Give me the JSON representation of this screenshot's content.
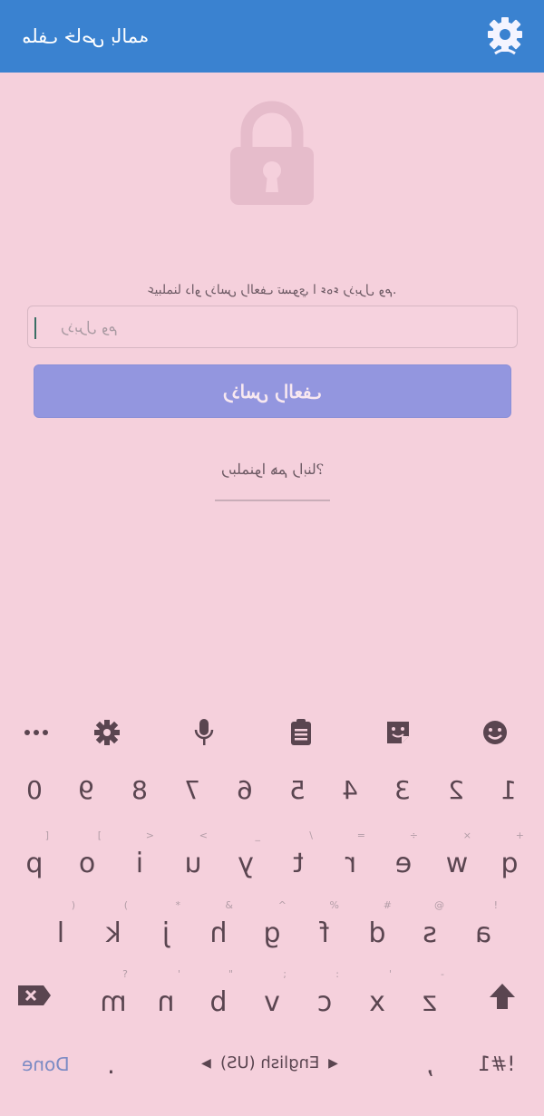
{
  "appbar": {
    "title": "ملف خاص بالمه",
    "accent": "#3a82d0"
  },
  "lock": {
    "icon": "lock-icon"
  },
  "prompt": {
    "text": ".عيبلمنا داو رذلس رالعف تسوي ا ءهء رذبرل وم"
  },
  "password": {
    "placeholder": "رذبرل وم"
  },
  "submit": {
    "label": "رذلس رالعف",
    "color": "#9396df"
  },
  "forgot": {
    "label": "?رىبلمنوا هم رابنا"
  },
  "keyboard": {
    "toolbar": [
      "more-icon",
      "settings-icon",
      "microphone-icon",
      "clipboard-icon",
      "sticker-icon",
      "emoji-icon"
    ],
    "numbers": [
      "0",
      "9",
      "8",
      "7",
      "6",
      "5",
      "4",
      "3",
      "2",
      "1"
    ],
    "row1": [
      {
        "k": "p",
        "h": "]"
      },
      {
        "k": "o",
        "h": "["
      },
      {
        "k": "i",
        "h": ">"
      },
      {
        "k": "u",
        "h": "<"
      },
      {
        "k": "y",
        "h": "_"
      },
      {
        "k": "t",
        "h": "\\"
      },
      {
        "k": "r",
        "h": "="
      },
      {
        "k": "e",
        "h": "÷"
      },
      {
        "k": "w",
        "h": "×"
      },
      {
        "k": "q",
        "h": "+"
      }
    ],
    "row2": [
      {
        "k": "l",
        "h": ")"
      },
      {
        "k": "k",
        "h": "("
      },
      {
        "k": "j",
        "h": "*"
      },
      {
        "k": "h",
        "h": "&"
      },
      {
        "k": "g",
        "h": "^"
      },
      {
        "k": "f",
        "h": "%"
      },
      {
        "k": "d",
        "h": "#"
      },
      {
        "k": "s",
        "h": "@"
      },
      {
        "k": "a",
        "h": "!"
      }
    ],
    "row3": [
      {
        "k": "m",
        "h": "?"
      },
      {
        "k": "n",
        "h": "'"
      },
      {
        "k": "b",
        "h": "\""
      },
      {
        "k": "v",
        "h": ";"
      },
      {
        "k": "c",
        "h": ":"
      },
      {
        "k": "x",
        "h": "'"
      },
      {
        "k": "z",
        "h": "-"
      }
    ],
    "bottom": {
      "done": "Done",
      "period": ".",
      "language": "English (US)",
      "comma": ",",
      "symbols": "!#1"
    }
  }
}
